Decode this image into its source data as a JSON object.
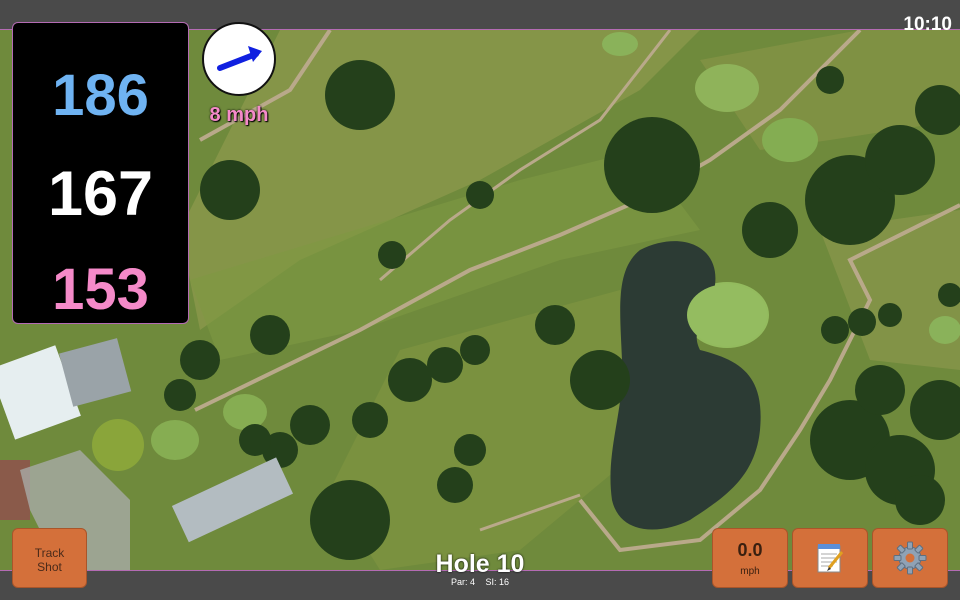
{
  "status": {
    "time": "10:10"
  },
  "yardage": {
    "back": "186",
    "center": "167",
    "front": "153"
  },
  "wind": {
    "speed": "8 mph",
    "icon": "wind-arrow-icon"
  },
  "hole": {
    "title": "Hole 10",
    "par": "Par: 4",
    "stroke_index": "SI: 16"
  },
  "buttons": {
    "track_shot_line1": "Track",
    "track_shot_line2": "Shot",
    "speed_value": "0.0",
    "speed_unit": "mph",
    "notes_icon": "notepad-icon",
    "settings_icon": "gear-icon"
  },
  "colors": {
    "accent_orange": "#d4703a",
    "back_yardage": "#6fb3f2",
    "front_yardage": "#f58ac9",
    "border": "#b46bb4"
  }
}
